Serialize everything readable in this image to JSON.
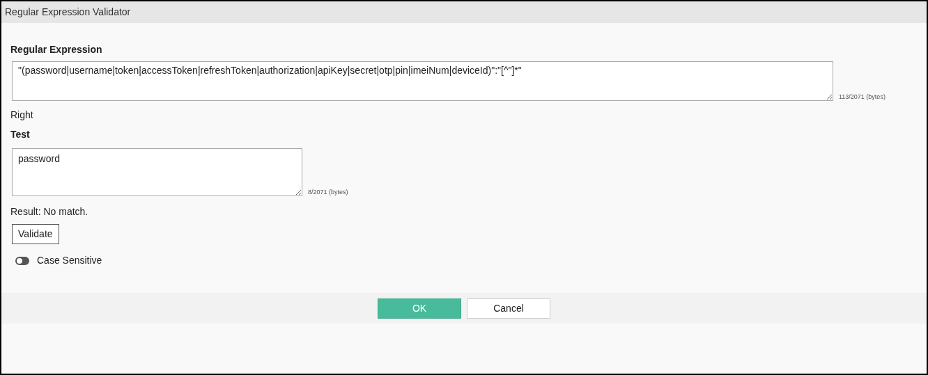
{
  "window": {
    "title": "Regular Expression Validator"
  },
  "regex": {
    "label": "Regular Expression",
    "value": "\"(password|username|token|accessToken|refreshToken|authorization|apiKey|secret|otp|pin|imeiNum|deviceId)\":\"[^\"]*\"",
    "counter": "113/2071 (bytes)"
  },
  "status": "Right",
  "test": {
    "label": "Test",
    "value": "password",
    "counter": "8/2071 (bytes)"
  },
  "result": "Result: No match.",
  "validate_button": "Validate",
  "case_sensitive": {
    "label": "Case Sensitive",
    "on": false
  },
  "buttons": [
    {
      "label": "OK",
      "kind": "primary"
    },
    {
      "label": "Cancel",
      "kind": "secondary"
    }
  ]
}
